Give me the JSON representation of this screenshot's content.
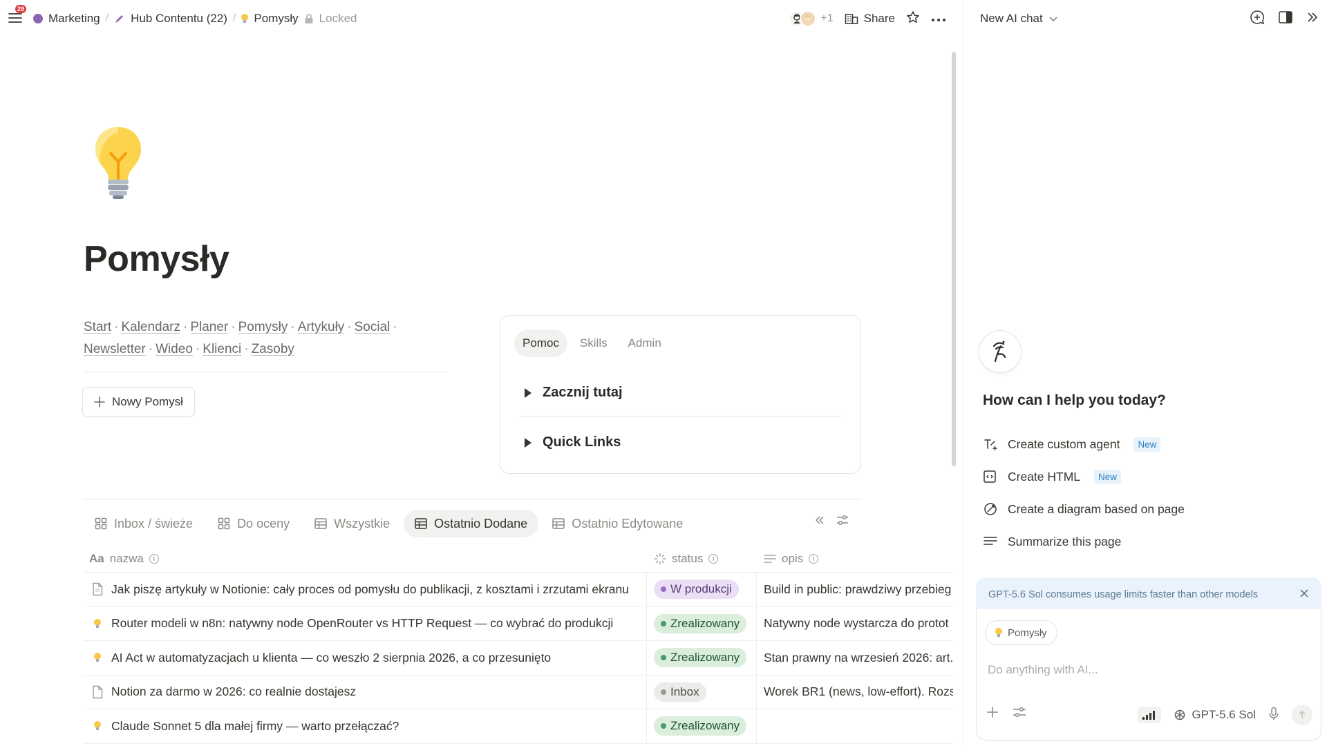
{
  "topbar": {
    "notification_count": "29",
    "breadcrumbs": [
      {
        "label": "Marketing"
      },
      {
        "label": "Hub Contentu (22)"
      },
      {
        "label": "Pomysły"
      }
    ],
    "locked_label": "Locked",
    "more_collaborators": "+1",
    "share_label": "Share"
  },
  "page": {
    "title": "Pomysły",
    "nav_links": [
      "Start",
      "Kalendarz",
      "Planer",
      "Pomysły",
      "Artykuły",
      "Social",
      "Newsletter",
      "Wideo",
      "Klienci",
      "Zasoby"
    ],
    "new_button_label": "Nowy Pomysł"
  },
  "panel": {
    "tabs": [
      {
        "label": "Pomoc",
        "active": true
      },
      {
        "label": "Skills",
        "active": false
      },
      {
        "label": "Admin",
        "active": false
      }
    ],
    "toggles": [
      "Zacznij tutaj",
      "Quick Links"
    ]
  },
  "database": {
    "views": [
      {
        "label": "Inbox / świeże",
        "icon": "gallery-icon",
        "active": false
      },
      {
        "label": "Do oceny",
        "icon": "gallery-icon",
        "active": false
      },
      {
        "label": "Wszystkie",
        "icon": "table-icon",
        "active": false
      },
      {
        "label": "Ostatnio Dodane",
        "icon": "table-icon",
        "active": true
      },
      {
        "label": "Ostatnio Edytowane",
        "icon": "table-icon",
        "active": false
      }
    ],
    "columns": [
      {
        "label": "nazwa",
        "prefix": "Aa"
      },
      {
        "label": "status"
      },
      {
        "label": "opis"
      }
    ],
    "rows": [
      {
        "icon": "page-icon",
        "name": "Jak piszę artykuły w Notionie: cały proces od pomysłu do publikacji, z kosztami i zrzutami ekranu",
        "status": "W produkcji",
        "status_color": "purple",
        "opis": "Build in public: prawdziwy przebieg"
      },
      {
        "icon": "bulb-icon",
        "name": "Router modeli w n8n: natywny node OpenRouter vs HTTP Request — co wybrać do produkcji",
        "status": "Zrealizowany",
        "status_color": "green",
        "opis": "Natywny node wystarcza do protot"
      },
      {
        "icon": "bulb-icon",
        "name": "AI Act w automatyzacjach u klienta — co weszło 2 sierpnia 2026, a co przesunięto",
        "status": "Zrealizowany",
        "status_color": "green",
        "opis": "Stan prawny na wrzesień 2026: art."
      },
      {
        "icon": "page-icon",
        "name": "Notion za darmo w 2026: co realnie dostajesz",
        "status": "Inbox",
        "status_color": "gray",
        "opis": "Worek BR1 (news, low-effort). Rozs"
      },
      {
        "icon": "bulb-icon",
        "name": "Claude Sonnet 5 dla małej firmy — warto przełączać?",
        "status": "Zrealizowany",
        "status_color": "green",
        "opis": ""
      }
    ]
  },
  "ai": {
    "chat_title": "New AI chat",
    "greeting": "How can I help you today?",
    "suggestions": [
      {
        "label": "Create custom agent",
        "badge": "New",
        "icon": "agent-icon"
      },
      {
        "label": "Create HTML",
        "badge": "New",
        "icon": "html-icon"
      },
      {
        "label": "Create a diagram based on page",
        "badge": "",
        "icon": "diagram-icon"
      },
      {
        "label": "Summarize this page",
        "badge": "",
        "icon": "lines-icon"
      }
    ],
    "notice": "GPT-5.6 Sol consumes usage limits faster than other models",
    "context_chip": "Pomysły",
    "input_placeholder": "Do anything with AI...",
    "model_label": "GPT-5.6 Sol"
  },
  "colors": {
    "accent_blue": "#2f80c6",
    "status_purple": "#eadff5",
    "status_green": "#dbeddb",
    "status_gray": "#ebebe9"
  }
}
